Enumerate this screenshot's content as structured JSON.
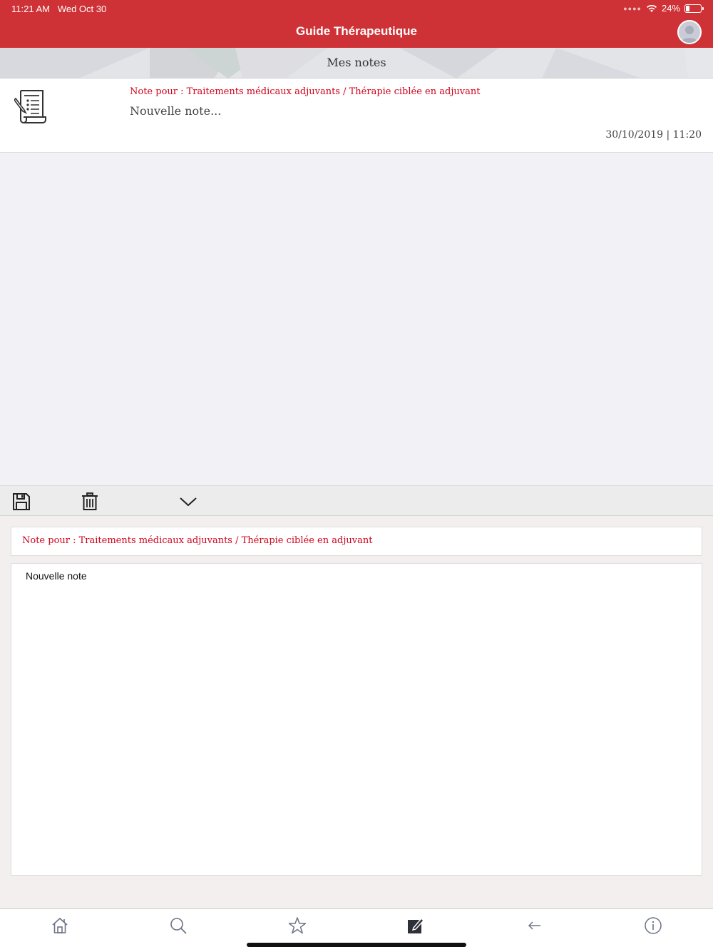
{
  "status_bar": {
    "time": "11:21 AM",
    "date": "Wed Oct 30",
    "battery": "24%",
    "battery_level": 0.24
  },
  "header": {
    "title": "Guide Thérapeutique"
  },
  "subheader": {
    "title": "Mes notes"
  },
  "notes": [
    {
      "for": "Note pour : Traitements médicaux adjuvants / Thérapie ciblée en adjuvant",
      "preview": "Nouvelle note...",
      "datetime": "30/10/2019 | 11:20"
    }
  ],
  "editor": {
    "for": "Note pour : Traitements médicaux adjuvants / Thérapie ciblée en adjuvant",
    "body": "Nouvelle note"
  },
  "colors": {
    "brand": "#cf3236",
    "accent_text": "#d0021b"
  },
  "icons": {
    "toolbar": [
      "save-icon",
      "trash-icon",
      "chevron-down-icon"
    ],
    "tabs": [
      "home-icon",
      "search-icon",
      "star-icon",
      "edit-note-icon",
      "back-arrow-icon",
      "info-icon"
    ]
  }
}
